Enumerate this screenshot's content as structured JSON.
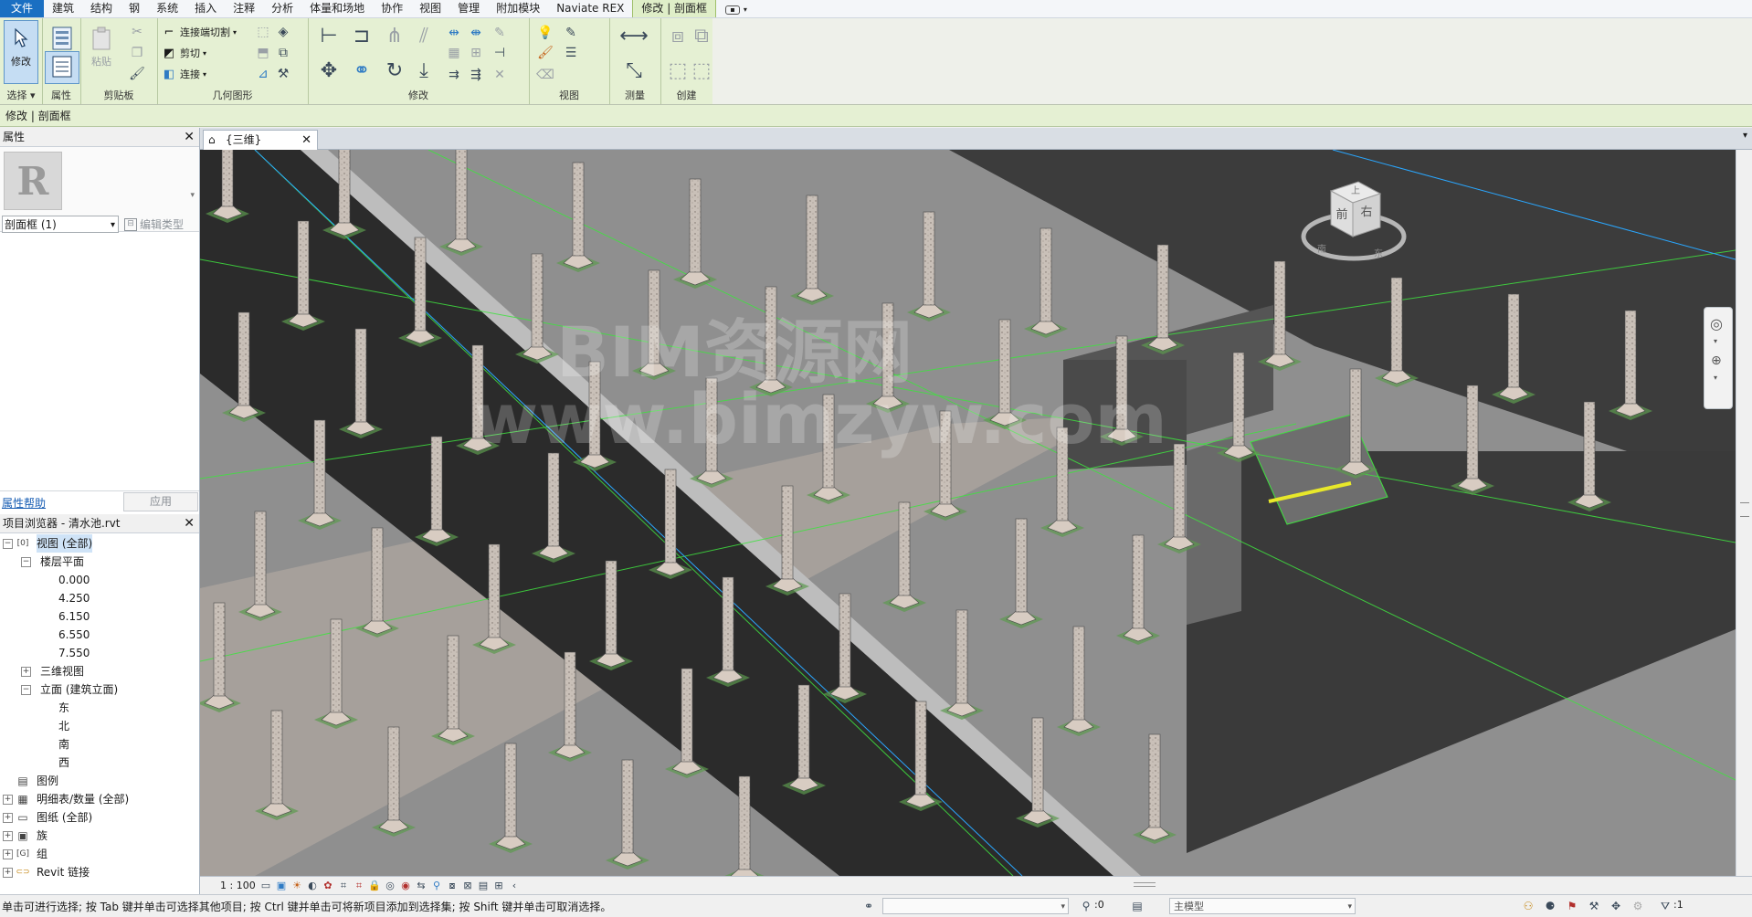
{
  "menubar": {
    "tabs": [
      "文件",
      "建筑",
      "结构",
      "钢",
      "系统",
      "插入",
      "注释",
      "分析",
      "体量和场地",
      "协作",
      "视图",
      "管理",
      "附加模块",
      "Naviate REX"
    ],
    "context_tab": "修改 | 剖面框"
  },
  "ribbon": {
    "modify_label": "修改",
    "select_label": "选择 ▾",
    "properties_label": "属性",
    "paste_label": "粘贴",
    "clipboard_label": "剪贴板",
    "cope_label": "连接端切割",
    "cut_label": "剪切",
    "join_label": "连接",
    "geometry_label": "几何图形",
    "modify_panel_label": "修改",
    "view_label": "视图",
    "measure_label": "测量",
    "create_label": "创建"
  },
  "optionsbar": {
    "text": "修改 | 剖面框"
  },
  "properties": {
    "title": "属性",
    "logo": "R",
    "type_selector": "剖面框 (1)",
    "edit_type": "编辑类型",
    "help_link": "属性帮助",
    "apply": "应用"
  },
  "browser": {
    "title": "项目浏览器 - 清水池.rvt",
    "items": [
      {
        "label": "视图 (全部)",
        "toggle": "−",
        "icon": "[0]"
      },
      {
        "label": "楼层平面",
        "toggle": "−",
        "icon": ""
      },
      {
        "label": "0.000"
      },
      {
        "label": "4.250"
      },
      {
        "label": "6.150"
      },
      {
        "label": "6.550"
      },
      {
        "label": "7.550"
      },
      {
        "label": "三维视图",
        "toggle": "+",
        "icon": ""
      },
      {
        "label": "立面 (建筑立面)",
        "toggle": "−",
        "icon": ""
      },
      {
        "label": "东"
      },
      {
        "label": "北"
      },
      {
        "label": "南"
      },
      {
        "label": "西"
      },
      {
        "label": "图例",
        "icon": "▤"
      },
      {
        "label": "明细表/数量 (全部)",
        "toggle": "+",
        "icon": "▦"
      },
      {
        "label": "图纸 (全部)",
        "toggle": "+",
        "icon": "▭"
      },
      {
        "label": "族",
        "toggle": "+",
        "icon": "▣"
      },
      {
        "label": "组",
        "toggle": "+",
        "icon": "[G]"
      },
      {
        "label": "Revit 链接",
        "toggle": "+",
        "icon": "⊂⊃"
      }
    ]
  },
  "view": {
    "tab_label": "{三维}",
    "scale": "1 : 100",
    "viewcube_top": "上",
    "viewcube_front": "前",
    "viewcube_right": "右",
    "compass_south": "南",
    "compass_east": "东",
    "watermark_line1": "BIM资源网",
    "watermark_line2": "www.bimzyw.com"
  },
  "status": {
    "text": "单击可进行选择; 按 Tab 键并单击可选择其他项目; 按 Ctrl 键并单击可将新项目添加到选择集; 按 Shift 键并单击可取消选择。",
    "workset_value": ":0",
    "model_field": "主模型",
    "filter_count": ":1"
  },
  "colors": {
    "file_tab": "#1a6fc2",
    "context_tab": "#dfeec8",
    "ribbon_bg": "#e5f0d3",
    "selection_blue": "#c5ddf3"
  }
}
